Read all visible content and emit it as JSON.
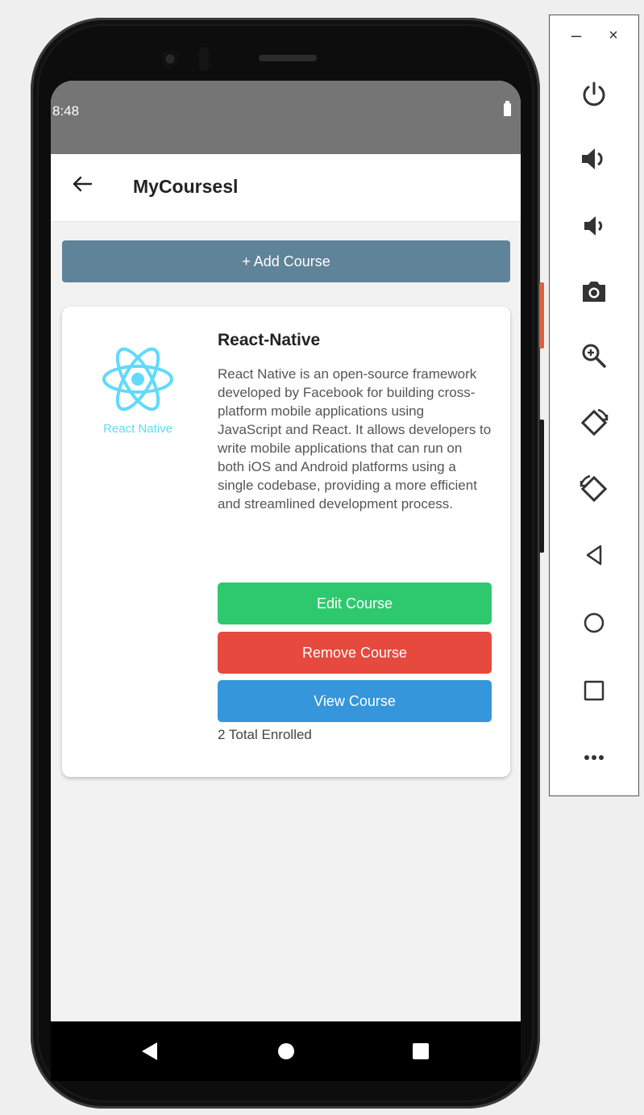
{
  "status_bar": {
    "time": "8:48"
  },
  "app_bar": {
    "title": "MyCoursesl"
  },
  "add_course": {
    "label": "+ Add Course"
  },
  "course": {
    "logo_text": "React Native",
    "title": "React-Native",
    "description": "React Native is an open-source framework developed by Facebook for building cross-platform mobile applications using JavaScript and React. It allows developers to write mobile applications that can run on both iOS and Android platforms using a single codebase, providing a more efficient and streamlined development process.",
    "edit_label": "Edit Course",
    "remove_label": "Remove Course",
    "view_label": "View Course",
    "enrolled_text": "2 Total Enrolled"
  },
  "emulator_panel": {
    "minimize": "–",
    "close": "×",
    "icons": [
      "power-icon",
      "volume-up-icon",
      "volume-down-icon",
      "camera-icon",
      "zoom-in-icon",
      "rotate-left-icon",
      "rotate-right-icon",
      "back-icon",
      "home-icon",
      "overview-icon",
      "more-icon"
    ]
  },
  "colors": {
    "add_button": "#5f8399",
    "edit_button": "#2ec96e",
    "remove_button": "#e6493d",
    "view_button": "#3596db",
    "react_logo": "#61dafb",
    "status_bar": "#757575"
  }
}
